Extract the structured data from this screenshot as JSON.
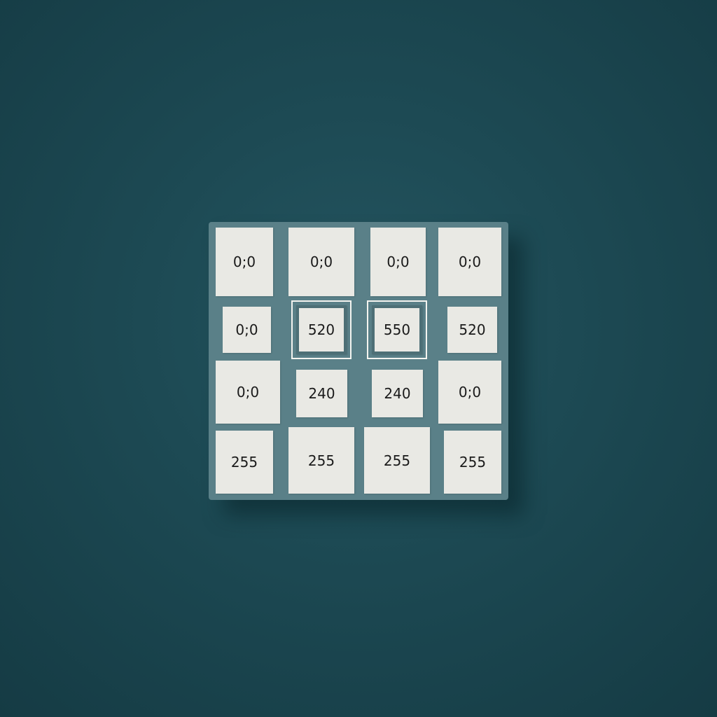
{
  "background_color": "#1d4a54",
  "board_color": "#5a8088",
  "cell_color": "#e9e9e4",
  "grid": {
    "rows": [
      {
        "cells": [
          {
            "value": "0;0"
          },
          {
            "value": "0;0"
          },
          {
            "value": "0;0"
          },
          {
            "value": "0;0"
          }
        ]
      },
      {
        "cells": [
          {
            "value": "0;0"
          },
          {
            "value": "520",
            "selected": true
          },
          {
            "value": "550",
            "selected": true
          },
          {
            "value": "520"
          }
        ]
      },
      {
        "cells": [
          {
            "value": "0;0"
          },
          {
            "value": "240"
          },
          {
            "value": "240"
          },
          {
            "value": "0;0"
          }
        ]
      },
      {
        "cells": [
          {
            "value": "255"
          },
          {
            "value": "255"
          },
          {
            "value": "255"
          },
          {
            "value": "255"
          }
        ]
      }
    ]
  }
}
